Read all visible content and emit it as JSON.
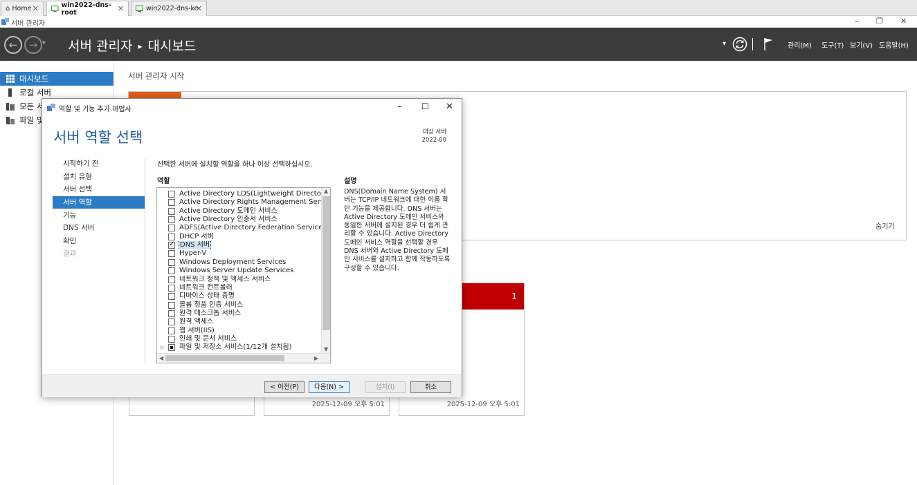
{
  "browser_tabs": [
    {
      "label": "Home"
    },
    {
      "label": "win2022-dns-root"
    },
    {
      "label": "win2022-dns-ke"
    }
  ],
  "window": {
    "title": "서버 관리자",
    "controls": [
      "–",
      "❐",
      "✕"
    ]
  },
  "header": {
    "app_name": "서버 관리자",
    "separator": "▸",
    "page": "대시보드",
    "menus": [
      "관리(M)",
      "도구(T)",
      "보기(V)",
      "도움말(H)"
    ],
    "dropdown_glyph": "▾"
  },
  "sidebar": {
    "items": [
      {
        "label": "대시보드",
        "icon": "dashboard-grid-icon"
      },
      {
        "label": "로컬 서버",
        "icon": "server-icon"
      },
      {
        "label": "모든 서버",
        "icon": "servers-icon"
      },
      {
        "label": "파일 및 저장소 서비스",
        "icon": "file-storage-icon"
      }
    ]
  },
  "dashboard": {
    "welcome_title": "서버 관리자 시작",
    "hide_label": "숨기기",
    "tile_badge": "1",
    "tile_dates": [
      "2025-12-09 오후 5:01",
      "2025-12-09 오후 5:01"
    ]
  },
  "wizard": {
    "title": "역할 및 기능 추가 마법사",
    "heading": "서버 역할 선택",
    "target_label": "대상 서버",
    "target_value": "2022-00",
    "steps": [
      {
        "label": "시작하기 전",
        "state": "normal"
      },
      {
        "label": "설치 유형",
        "state": "normal"
      },
      {
        "label": "서버 선택",
        "state": "normal"
      },
      {
        "label": "서버 역할",
        "state": "active"
      },
      {
        "label": "기능",
        "state": "normal"
      },
      {
        "label": "DNS 서버",
        "state": "normal"
      },
      {
        "label": "확인",
        "state": "normal"
      },
      {
        "label": "결과",
        "state": "disabled"
      }
    ],
    "instruction": "선택한 서버에 설치할 역할을 하나 이상 선택하십시오.",
    "roles_label": "역할",
    "roles": [
      {
        "label": "Active Directory LDS(Lightweight Directory Services)",
        "checked": false
      },
      {
        "label": "Active Directory Rights Management Services",
        "checked": false
      },
      {
        "label": "Active Directory 도메인 서비스",
        "checked": false
      },
      {
        "label": "Active Directory 인증서 서비스",
        "checked": false
      },
      {
        "label": "ADFS(Active Directory Federation Services)",
        "checked": false
      },
      {
        "label": "DHCP 서버",
        "checked": false
      },
      {
        "label": "DNS 서버",
        "checked": true,
        "selected": true
      },
      {
        "label": "Hyper-V",
        "checked": false
      },
      {
        "label": "Windows Deployment Services",
        "checked": false
      },
      {
        "label": "Windows Server Update Services",
        "checked": false
      },
      {
        "label": "네트워크 정책 및 액세스 서비스",
        "checked": false
      },
      {
        "label": "네트워크 컨트롤러",
        "checked": false
      },
      {
        "label": "디바이스 상태 증명",
        "checked": false
      },
      {
        "label": "볼륨 정품 인증 서비스",
        "checked": false
      },
      {
        "label": "원격 데스크톱 서비스",
        "checked": false
      },
      {
        "label": "원격 액세스",
        "checked": false
      },
      {
        "label": "웹 서버(IIS)",
        "checked": false
      },
      {
        "label": "인쇄 및 문서 서비스",
        "checked": false
      },
      {
        "label": "파일 및 저장소 서비스(1/12개 설치됨)",
        "checked": "partial",
        "expandable": true
      }
    ],
    "description_label": "설명",
    "description": "DNS(Domain Name System) 서버는 TCP/IP 네트워크에 대한 이름 확인 기능을 제공합니다. DNS 서버는 Active Directory 도메인 서비스와 동일한 서버에 설치된 경우 더 쉽게 관리할 수 있습니다. Active Directory 도메인 서비스 역할을 선택할 경우 DNS 서버와 Active Directory 도메인 서비스를 설치하고 함께 작동하도록 구성할 수 있습니다.",
    "buttons": {
      "previous": "< 이전(P)",
      "next": "다음(N) >",
      "install": "설치(I)",
      "cancel": "취소"
    }
  }
}
